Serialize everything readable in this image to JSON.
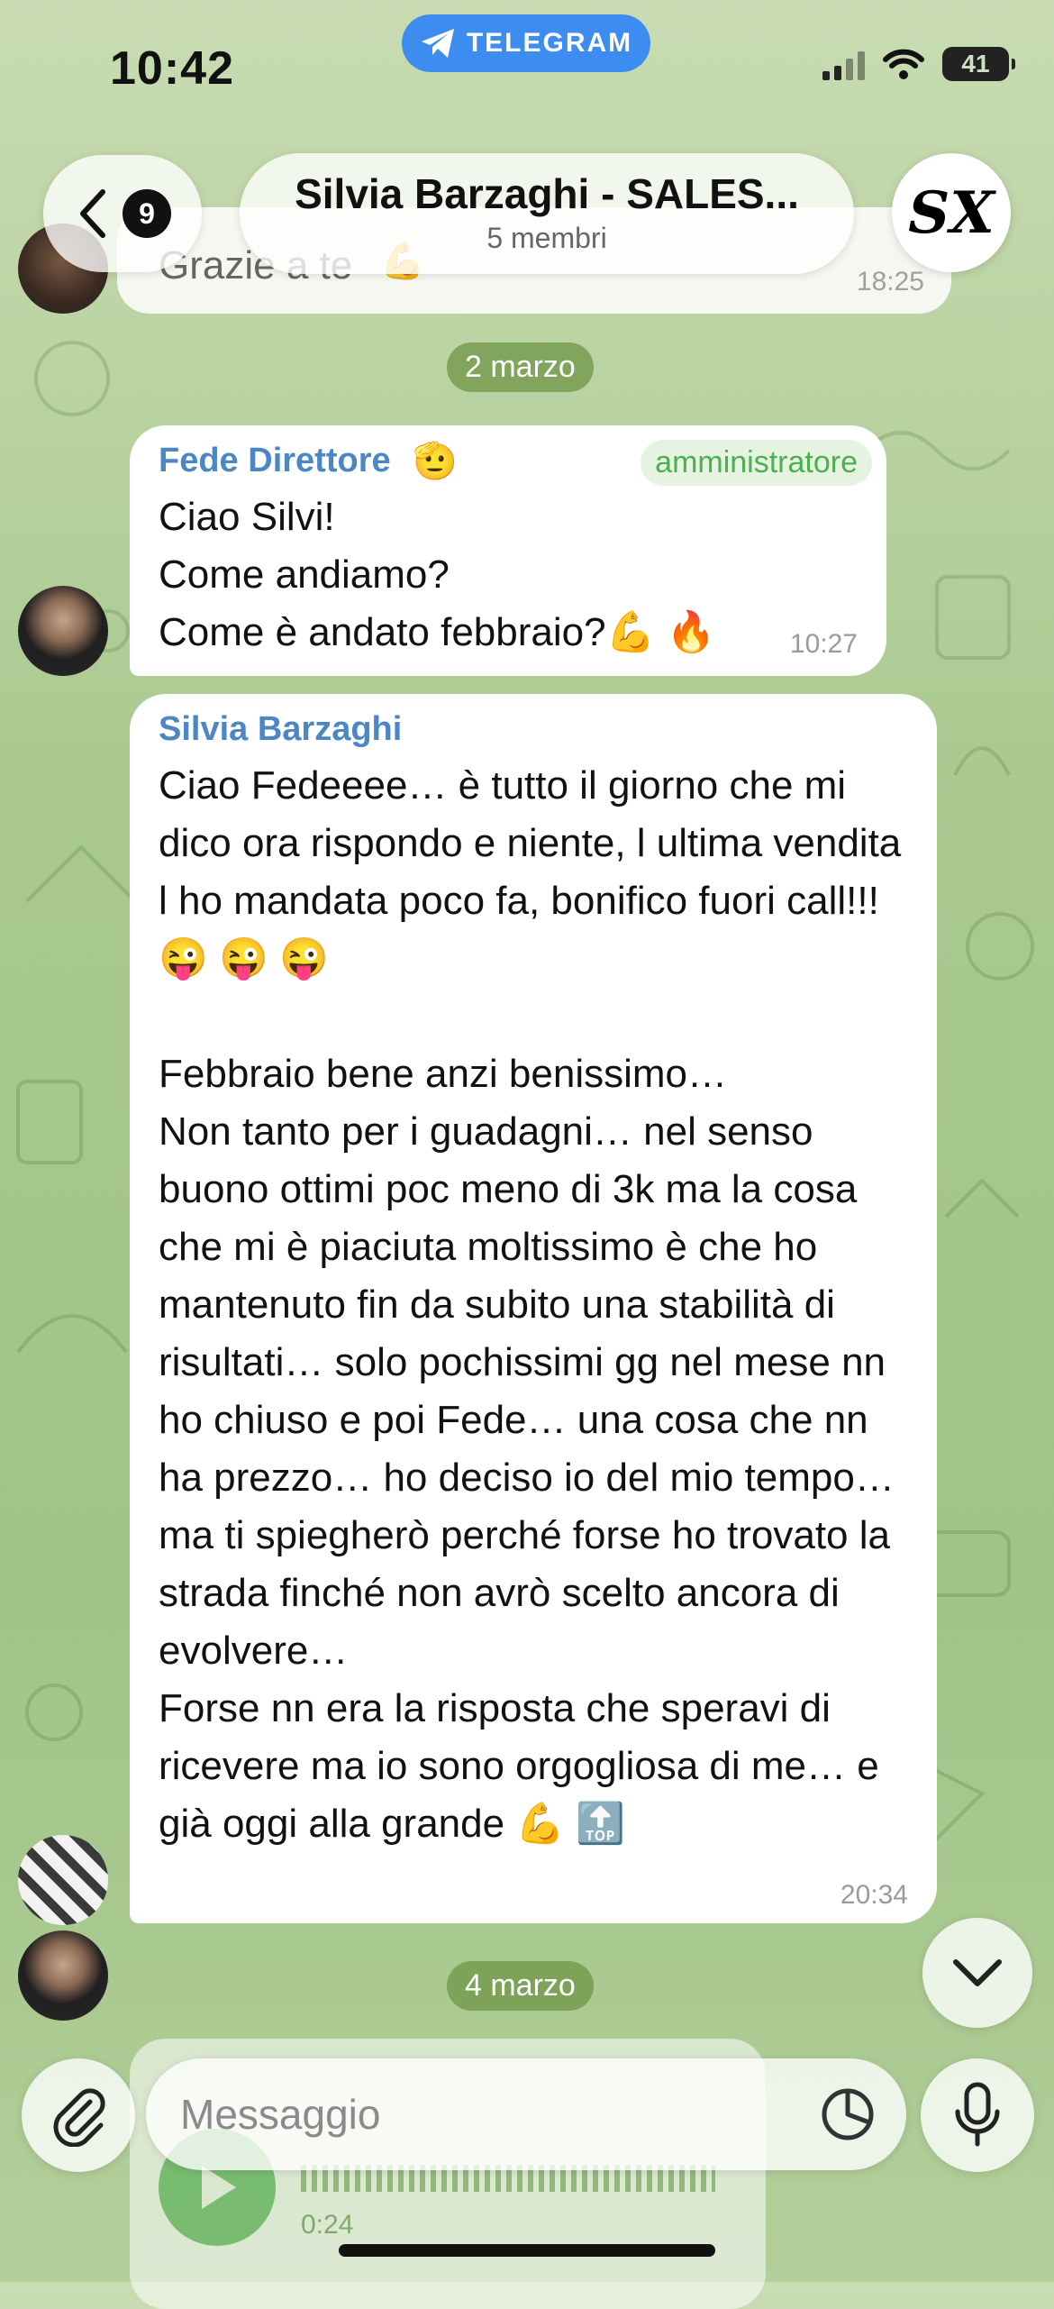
{
  "status_bar": {
    "time": "10:42",
    "app_pill": "TELEGRAM",
    "battery": "41"
  },
  "header": {
    "unread_count": "9",
    "title": "Silvia Barzaghi - SALES...",
    "subtitle": "5 membri",
    "group_avatar": "SX"
  },
  "previous_message": {
    "text": "Grazie a te",
    "time": "18:25"
  },
  "dates": {
    "first": "2 marzo",
    "second": "4 marzo"
  },
  "messages": [
    {
      "sender": "Fede Direttore",
      "role_badge": "amministratore",
      "text": "Ciao Silvi!\nCome andiamo?\nCome è andato febbraio?💪 🔥",
      "time": "10:27"
    },
    {
      "sender": "Silvia Barzaghi",
      "text": "Ciao Fedeeee… è tutto il giorno che mi dico ora rispondo e niente, l ultima vendita l ho mandata poco fa, bonifico fuori call!!!😜 😜 😜\n\nFebbraio bene anzi benissimo…\nNon tanto per i guadagni… nel senso buono ottimi poc meno di 3k ma la cosa che mi è piaciuta moltissimo è che ho mantenuto fin da subito una stabilità di risultati… solo pochissimi gg nel mese nn ho chiuso e poi Fede… una cosa che nn ha prezzo… ho deciso io del mio tempo… ma ti spiegherò perché forse ho trovato la strada finché non avrò scelto ancora di evolvere…\nForse nn era la risposta che speravi di ricevere ma io sono orgogliosa di me… e già oggi alla grande 💪 🔝",
      "time": "20:34"
    }
  ],
  "voice_message": {
    "duration": "0:24"
  },
  "composer": {
    "placeholder": "Messaggio"
  },
  "colors": {
    "accent": "#3d8cf0",
    "sender_name": "#4a87c4",
    "admin_badge": "#4caf50",
    "date_pill": "#6e9646"
  },
  "icons": [
    "telegram-icon",
    "signal-icon",
    "wifi-icon",
    "battery-icon",
    "back-chevron-icon",
    "paperclip-icon",
    "sticker-icon",
    "microphone-icon",
    "scroll-down-icon",
    "play-icon"
  ]
}
